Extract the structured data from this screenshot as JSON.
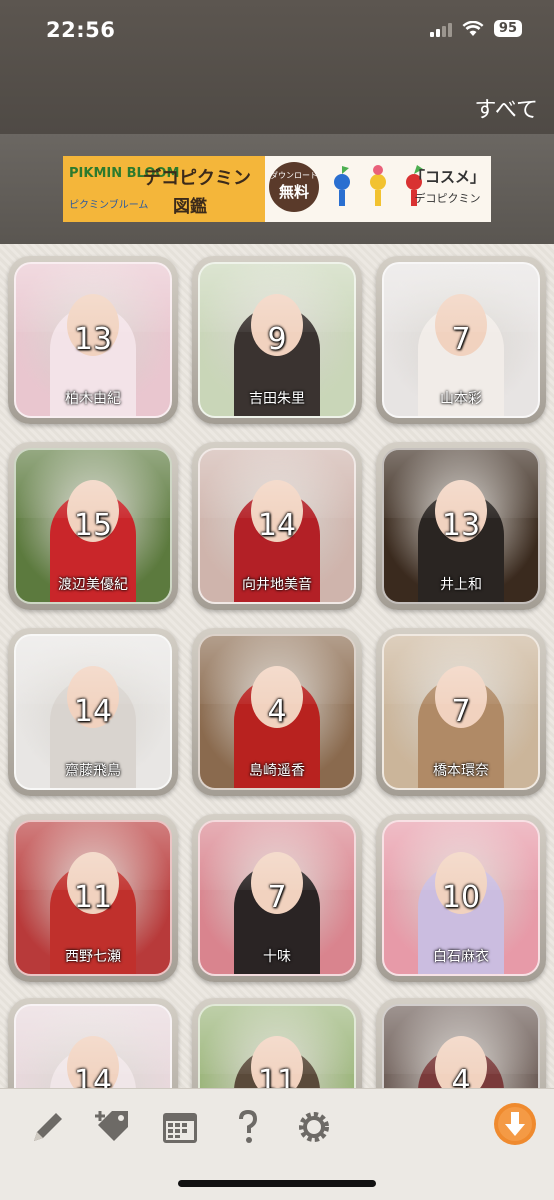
{
  "status_bar": {
    "time": "22:56",
    "battery": "95"
  },
  "header": {
    "filter_label": "すべて"
  },
  "ad": {
    "brand": "PIKMIN BLOOM",
    "title": "デコピクミン",
    "subtitle": "図鑑",
    "small": "ピクミンブルーム",
    "badge_top": "ダウンロード",
    "badge_main": "無料",
    "cosme": "「コスメ」",
    "cosme_sub": "デコピクミン"
  },
  "tiles": [
    {
      "name": "柏木由紀",
      "count": "13",
      "bg": "#e9c6cf",
      "outfit": "#f3e3e8"
    },
    {
      "name": "吉田朱里",
      "count": "9",
      "bg": "#c9d6b8",
      "outfit": "#3a3330"
    },
    {
      "name": "山本彩",
      "count": "7",
      "bg": "#e7e4e3",
      "outfit": "#f1ece8"
    },
    {
      "name": "渡辺美優紀",
      "count": "15",
      "bg": "#5c7a3e",
      "outfit": "#c9262a"
    },
    {
      "name": "向井地美音",
      "count": "14",
      "bg": "#cfb4ac",
      "outfit": "#b32026"
    },
    {
      "name": "井上和",
      "count": "13",
      "bg": "#3a2a1e",
      "outfit": "#2a2522"
    },
    {
      "name": "齋藤飛鳥",
      "count": "14",
      "bg": "#e8e6e4",
      "outfit": "#d9d4cf"
    },
    {
      "name": "島崎遥香",
      "count": "4",
      "bg": "#8a6a4e",
      "outfit": "#b8221f"
    },
    {
      "name": "橋本環奈",
      "count": "7",
      "bg": "#cbb59a",
      "outfit": "#b08a66"
    },
    {
      "name": "西野七瀬",
      "count": "11",
      "bg": "#b83a3a",
      "outfit": "#c0302c"
    },
    {
      "name": "十味",
      "count": "7",
      "bg": "#d9848e",
      "outfit": "#2a2424"
    },
    {
      "name": "白石麻衣",
      "count": "10",
      "bg": "#e79aa8",
      "outfit": "#cbbde0"
    },
    {
      "name": "",
      "count": "14",
      "bg": "#e8d8dc",
      "outfit": "#f0e6e8"
    },
    {
      "name": "",
      "count": "11",
      "bg": "#9bb57a",
      "outfit": "#5a4a3a"
    },
    {
      "name": "",
      "count": "4",
      "bg": "#6a5a54",
      "outfit": "#7a3a3a"
    }
  ],
  "toolbar": {
    "icons": [
      "pencil-icon",
      "tag-add-icon",
      "calendar-icon",
      "help-icon",
      "settings-icon",
      "download-icon"
    ]
  },
  "colors": {
    "accent": "#ef8a2e",
    "header": "#4f4a45",
    "icon": "#6d6a66"
  }
}
